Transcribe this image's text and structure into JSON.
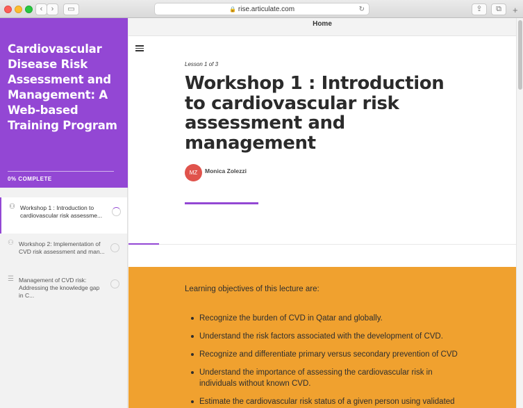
{
  "browser": {
    "url": "rise.articulate.com",
    "back_glyph": "‹",
    "forward_glyph": "›",
    "sidebar_glyph": "▭",
    "share_glyph": "⇪",
    "tabs_glyph": "⧉",
    "reload_glyph": "↻",
    "new_tab_glyph": "+"
  },
  "sidebar": {
    "course_title": "Cardiovascular Disease Risk Assessment and Management: A Web-based Training Program",
    "progress_label": "0% COMPLETE",
    "lessons": [
      {
        "label": "Workshop 1 : Introduction to cardiovascular risk assessme...",
        "icon": "person-icon",
        "glyph": "⚇",
        "active": true
      },
      {
        "label": "Workshop 2: Implementation of CVD risk assessment and man...",
        "icon": "person-icon",
        "glyph": "⚇",
        "active": false
      },
      {
        "label": "Management of CVD risk: Addressing the knowledge gap in C...",
        "icon": "text-lines-icon",
        "glyph": "☰",
        "active": false
      }
    ]
  },
  "main": {
    "topbar_title": "Home",
    "lesson_count": "Lesson 1 of 3",
    "lesson_title": "Workshop 1 : Introduction to cardiovascular risk assessment and management",
    "author_initials": "MZ",
    "author_name": "Monica Zolezzi",
    "objectives_intro": "Learning objectives of this lecture are:",
    "objectives": [
      "Recognize the burden of CVD in Qatar and globally.",
      "Understand the risk factors associated with the development of CVD.",
      "Recognize and differentiate primary versus secondary prevention of CVD",
      "Understand the importance of assessing the cardiovascular risk in individuals without known CVD.",
      "Estimate the cardiovascular risk status of a given person using validated"
    ]
  },
  "colors": {
    "accent": "#9347d4",
    "objectives_bg": "#f0a12f",
    "avatar_bg": "#e0534c"
  }
}
